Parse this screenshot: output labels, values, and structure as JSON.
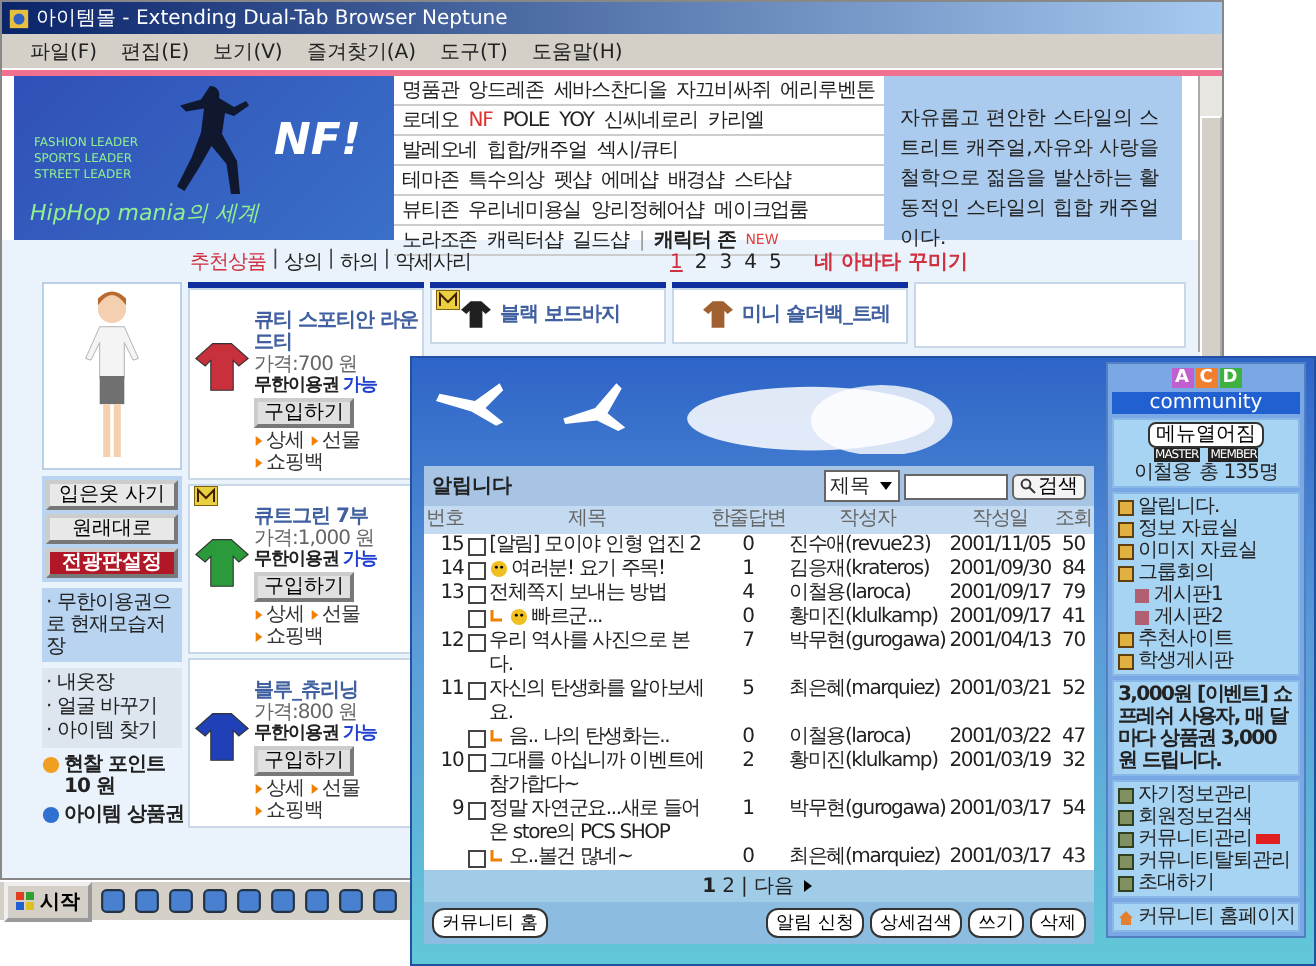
{
  "browser": {
    "title": "아이템몰 - Extending Dual-Tab Browser Neptune",
    "menu": [
      "파일(F)",
      "편집(E)",
      "보기(V)",
      "즐겨찾기(A)",
      "도구(T)",
      "도움말(H)"
    ]
  },
  "banner": {
    "slogans": [
      "FASHION LEADER",
      "SPORTS LEADER",
      "STREET LEADER"
    ],
    "logo": "NF!",
    "tagline": "HipHop mania의 세계",
    "brand_rows": [
      [
        {
          "text": "명품관",
          "kind": "plain"
        },
        {
          "text": "앙드레존",
          "kind": "plain"
        },
        {
          "text": "세바스찬디올",
          "kind": "plain"
        },
        {
          "text": "자끄비싸쥐",
          "kind": "plain"
        },
        {
          "text": "에리루벤톤",
          "kind": "plain"
        }
      ],
      [
        {
          "text": "로데오",
          "kind": "plain"
        },
        {
          "text": "NF",
          "kind": "accent"
        },
        {
          "text": "POLE",
          "kind": "plain"
        },
        {
          "text": "YOY",
          "kind": "plain"
        },
        {
          "text": "신씨네로리",
          "kind": "plain"
        },
        {
          "text": "카리엘",
          "kind": "plain"
        }
      ],
      [
        {
          "text": "발레오네",
          "kind": "plain"
        },
        {
          "text": "힙합/캐주얼",
          "kind": "plain"
        },
        {
          "text": "섹시/큐티",
          "kind": "plain"
        }
      ],
      [
        {
          "text": "테마존",
          "kind": "plain"
        },
        {
          "text": "특수의상",
          "kind": "plain"
        },
        {
          "text": "펫샵",
          "kind": "plain"
        },
        {
          "text": "에메샵",
          "kind": "plain"
        },
        {
          "text": "배경샵",
          "kind": "plain"
        },
        {
          "text": "스타샵",
          "kind": "plain"
        }
      ],
      [
        {
          "text": "뷰티존",
          "kind": "plain"
        },
        {
          "text": "우리네미용실",
          "kind": "plain"
        },
        {
          "text": "앙리정헤어샵",
          "kind": "plain"
        },
        {
          "text": "메이크업룸",
          "kind": "plain"
        }
      ],
      [
        {
          "text": "노라조존",
          "kind": "plain"
        },
        {
          "text": "캐릭터샵",
          "kind": "plain"
        },
        {
          "text": "길드샵",
          "kind": "plain"
        },
        {
          "text": "|",
          "kind": "separator"
        },
        {
          "text": "캐릭터 존",
          "kind": "bold"
        },
        {
          "text": "NEW",
          "kind": "new"
        }
      ]
    ],
    "description": "자유롭고 편안한 스타일의 스트리트 캐주얼,자유와 사랑을 철학으로 젊음을 발산하는 활동적인 스타일의 힙합 캐주얼이다."
  },
  "category_nav": {
    "separator": "|",
    "tabs": [
      {
        "label": "추천상품",
        "selected": true
      },
      {
        "label": "상의",
        "selected": false
      },
      {
        "label": "하의",
        "selected": false
      },
      {
        "label": "악세사리",
        "selected": false
      }
    ],
    "pages": [
      {
        "label": "1",
        "selected": true
      },
      {
        "label": "2",
        "selected": false
      },
      {
        "label": "3",
        "selected": false
      },
      {
        "label": "4",
        "selected": false
      },
      {
        "label": "5",
        "selected": false
      }
    ],
    "avatar_link": "네 아바타 꾸미기"
  },
  "avatar_panel": {
    "buttons": [
      {
        "label": "입은옷 사기",
        "kind": "normal"
      },
      {
        "label": "원래대로",
        "kind": "normal"
      },
      {
        "label": "전광판설정",
        "kind": "alert"
      }
    ],
    "save_note": "· 무한이용권으로 현재모습저장",
    "links": [
      "· 내옷장",
      "· 얼굴 바꾸기",
      "· 아이템 찾기"
    ],
    "points": [
      {
        "label": "현찰 포인트",
        "value": "10 원",
        "kind": "cash"
      },
      {
        "label": "아이템 상품권",
        "kind": "voucher"
      }
    ]
  },
  "products": [
    {
      "name": "큐티 스포티안 라운드티",
      "price": "가격:700 원",
      "pass_label": "무한이용권",
      "pass_status": "가능",
      "buy": "구입하기",
      "links": [
        "상세",
        "선물",
        "쇼핑백"
      ],
      "badge": false,
      "color": "#c8303c"
    },
    {
      "name": "큐트그린 7부",
      "price": "가격:1,000 원",
      "pass_label": "무한이용권",
      "pass_status": "가능",
      "buy": "구입하기",
      "links": [
        "상세",
        "선물",
        "쇼핑백"
      ],
      "badge": true,
      "color": "#2a9a3a"
    },
    {
      "name": "블루_츄리닝",
      "price": "가격:800 원",
      "pass_label": "무한이용권",
      "pass_status": "가능",
      "buy": "구입하기",
      "links": [
        "상세",
        "선물",
        "쇼핑백"
      ],
      "badge": false,
      "color": "#2040b8"
    }
  ],
  "more_products": [
    {
      "name": "블랙 보드바지",
      "badge": true,
      "color": "#202020"
    },
    {
      "name": "미니 숄더백_트레",
      "badge": false,
      "color": "#a06030"
    }
  ],
  "taskbar": {
    "start": "시작"
  },
  "community": {
    "board": {
      "title": "알립니다",
      "search_scope": "제목",
      "search_button": "검색",
      "columns": [
        "번호",
        "제목",
        "한줄답변",
        "작성자",
        "작성일",
        "조회"
      ],
      "rows": [
        {
          "num": "15",
          "title": "[알림] 모이야 인형 업진 2",
          "replies": "0",
          "author": "진수애(revue23)",
          "date": "2001/11/05",
          "views": "50",
          "kind": "post",
          "emoticon": false,
          "checked": false
        },
        {
          "num": "14",
          "title": "여러분! 요기 주목!",
          "replies": "1",
          "author": "김응재(krateros)",
          "date": "2001/09/30",
          "views": "84",
          "kind": "post",
          "emoticon": true,
          "checked": false
        },
        {
          "num": "13",
          "title": "전체쪽지 보내는 방법",
          "replies": "4",
          "author": "이철용(laroca)",
          "date": "2001/09/17",
          "views": "79",
          "kind": "post",
          "emoticon": false,
          "checked": false
        },
        {
          "num": "",
          "title": "빠르군...",
          "replies": "0",
          "author": "황미진(klulkamp)",
          "date": "2001/09/17",
          "views": "41",
          "kind": "reply",
          "emoticon": true,
          "checked": false
        },
        {
          "num": "12",
          "title": "우리 역사를 사진으로 본다.",
          "replies": "7",
          "author": "박무현(gurogawa)",
          "date": "2001/04/13",
          "views": "70",
          "kind": "post",
          "emoticon": false,
          "checked": false
        },
        {
          "num": "11",
          "title": "자신의 탄생화를 알아보세요.",
          "replies": "5",
          "author": "최은혜(marquiez)",
          "date": "2001/03/21",
          "views": "52",
          "kind": "post",
          "emoticon": false,
          "checked": false
        },
        {
          "num": "",
          "title": "음.. 나의 탄생화는..",
          "replies": "0",
          "author": "이철용(laroca)",
          "date": "2001/03/22",
          "views": "47",
          "kind": "reply",
          "emoticon": false,
          "checked": false
        },
        {
          "num": "10",
          "title": "그대를 아십니까 이벤트에 참가합다~",
          "replies": "2",
          "author": "황미진(klulkamp)",
          "date": "2001/03/19",
          "views": "32",
          "kind": "post",
          "emoticon": false,
          "checked": false
        },
        {
          "num": "9",
          "title": "정말 자연군요...새로 들어온 store의 PCS SHOP",
          "replies": "1",
          "author": "박무현(gurogawa)",
          "date": "2001/03/17",
          "views": "54",
          "kind": "post",
          "emoticon": false,
          "checked": false
        },
        {
          "num": "",
          "title": "오..볼건 많네~",
          "replies": "0",
          "author": "최은혜(marquiez)",
          "date": "2001/03/17",
          "views": "43",
          "kind": "reply",
          "emoticon": false,
          "checked": false
        }
      ],
      "pager": [
        {
          "label": "1",
          "selected": true
        },
        {
          "label": "2",
          "selected": false
        }
      ],
      "pager_separator": "|",
      "next": "다음",
      "home_button": "커뮤니티 홈",
      "actions": [
        "알림 신청",
        "상세검색",
        "쓰기",
        "삭제"
      ]
    },
    "sidebar": {
      "logo_letters": [
        "A",
        "C",
        "D"
      ],
      "header": "community",
      "open_button": "메뉴열어짐",
      "badges": [
        "MASTER",
        "MEMBER"
      ],
      "master": "이철용",
      "member_count": "총 135명",
      "menu": [
        {
          "label": "알립니다."
        },
        {
          "label": "정보 자료실"
        },
        {
          "label": "이미지 자료실"
        },
        {
          "label": "그룹회의",
          "children": [
            {
              "label": "게시판1"
            },
            {
              "label": "게시판2"
            }
          ]
        },
        {
          "label": "추천사이트"
        },
        {
          "label": "학생게시판"
        }
      ],
      "notice": "3,000원 [이벤트] 쇼프레쉬 사용자, 매 달마다 상품권 3,000원 드립니다.",
      "admin": [
        {
          "label": "자기정보관리",
          "new": false
        },
        {
          "label": "회원정보검색",
          "new": false
        },
        {
          "label": "커뮤니티관리",
          "new": true
        },
        {
          "label": "커뮤니티탈퇴관리",
          "new": false
        },
        {
          "label": "초대하기",
          "new": false
        }
      ],
      "footer": "커뮤니티 홈페이지"
    }
  }
}
